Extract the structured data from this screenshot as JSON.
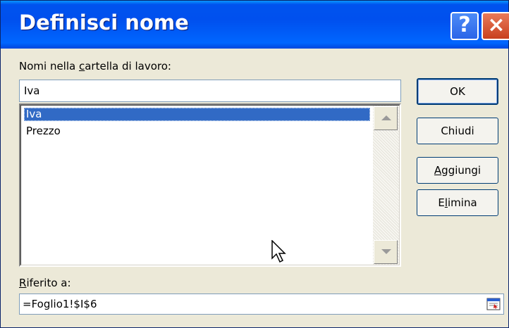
{
  "dialog": {
    "title": "Definisci nome",
    "help_icon": "?",
    "close_icon": "×"
  },
  "names_label": {
    "pre": "Nomi nella ",
    "accel": "c",
    "post": "artella di lavoro:"
  },
  "name_input": {
    "value": "Iva"
  },
  "names_list": {
    "items": [
      {
        "label": "Iva",
        "selected": true
      },
      {
        "label": "Prezzo",
        "selected": false
      }
    ]
  },
  "buttons": {
    "ok": "OK",
    "close": "Chiudi",
    "add": {
      "accel": "A",
      "rest": "ggiungi"
    },
    "delete": {
      "pre": "E",
      "accel": "l",
      "rest": "imina"
    }
  },
  "ref_label": {
    "accel": "R",
    "rest": "iferito a:"
  },
  "ref_input": {
    "value": "=Foglio1!$I$6"
  }
}
